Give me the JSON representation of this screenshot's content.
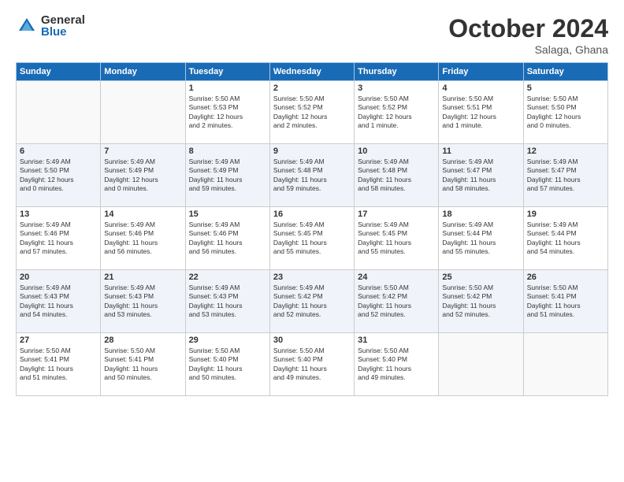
{
  "header": {
    "logo_general": "General",
    "logo_blue": "Blue",
    "month_title": "October 2024",
    "location": "Salaga, Ghana"
  },
  "weekdays": [
    "Sunday",
    "Monday",
    "Tuesday",
    "Wednesday",
    "Thursday",
    "Friday",
    "Saturday"
  ],
  "weeks": [
    [
      {
        "day": "",
        "info": ""
      },
      {
        "day": "",
        "info": ""
      },
      {
        "day": "1",
        "info": "Sunrise: 5:50 AM\nSunset: 5:53 PM\nDaylight: 12 hours\nand 2 minutes."
      },
      {
        "day": "2",
        "info": "Sunrise: 5:50 AM\nSunset: 5:52 PM\nDaylight: 12 hours\nand 2 minutes."
      },
      {
        "day": "3",
        "info": "Sunrise: 5:50 AM\nSunset: 5:52 PM\nDaylight: 12 hours\nand 1 minute."
      },
      {
        "day": "4",
        "info": "Sunrise: 5:50 AM\nSunset: 5:51 PM\nDaylight: 12 hours\nand 1 minute."
      },
      {
        "day": "5",
        "info": "Sunrise: 5:50 AM\nSunset: 5:50 PM\nDaylight: 12 hours\nand 0 minutes."
      }
    ],
    [
      {
        "day": "6",
        "info": "Sunrise: 5:49 AM\nSunset: 5:50 PM\nDaylight: 12 hours\nand 0 minutes."
      },
      {
        "day": "7",
        "info": "Sunrise: 5:49 AM\nSunset: 5:49 PM\nDaylight: 12 hours\nand 0 minutes."
      },
      {
        "day": "8",
        "info": "Sunrise: 5:49 AM\nSunset: 5:49 PM\nDaylight: 11 hours\nand 59 minutes."
      },
      {
        "day": "9",
        "info": "Sunrise: 5:49 AM\nSunset: 5:48 PM\nDaylight: 11 hours\nand 59 minutes."
      },
      {
        "day": "10",
        "info": "Sunrise: 5:49 AM\nSunset: 5:48 PM\nDaylight: 11 hours\nand 58 minutes."
      },
      {
        "day": "11",
        "info": "Sunrise: 5:49 AM\nSunset: 5:47 PM\nDaylight: 11 hours\nand 58 minutes."
      },
      {
        "day": "12",
        "info": "Sunrise: 5:49 AM\nSunset: 5:47 PM\nDaylight: 11 hours\nand 57 minutes."
      }
    ],
    [
      {
        "day": "13",
        "info": "Sunrise: 5:49 AM\nSunset: 5:46 PM\nDaylight: 11 hours\nand 57 minutes."
      },
      {
        "day": "14",
        "info": "Sunrise: 5:49 AM\nSunset: 5:46 PM\nDaylight: 11 hours\nand 56 minutes."
      },
      {
        "day": "15",
        "info": "Sunrise: 5:49 AM\nSunset: 5:46 PM\nDaylight: 11 hours\nand 56 minutes."
      },
      {
        "day": "16",
        "info": "Sunrise: 5:49 AM\nSunset: 5:45 PM\nDaylight: 11 hours\nand 55 minutes."
      },
      {
        "day": "17",
        "info": "Sunrise: 5:49 AM\nSunset: 5:45 PM\nDaylight: 11 hours\nand 55 minutes."
      },
      {
        "day": "18",
        "info": "Sunrise: 5:49 AM\nSunset: 5:44 PM\nDaylight: 11 hours\nand 55 minutes."
      },
      {
        "day": "19",
        "info": "Sunrise: 5:49 AM\nSunset: 5:44 PM\nDaylight: 11 hours\nand 54 minutes."
      }
    ],
    [
      {
        "day": "20",
        "info": "Sunrise: 5:49 AM\nSunset: 5:43 PM\nDaylight: 11 hours\nand 54 minutes."
      },
      {
        "day": "21",
        "info": "Sunrise: 5:49 AM\nSunset: 5:43 PM\nDaylight: 11 hours\nand 53 minutes."
      },
      {
        "day": "22",
        "info": "Sunrise: 5:49 AM\nSunset: 5:43 PM\nDaylight: 11 hours\nand 53 minutes."
      },
      {
        "day": "23",
        "info": "Sunrise: 5:49 AM\nSunset: 5:42 PM\nDaylight: 11 hours\nand 52 minutes."
      },
      {
        "day": "24",
        "info": "Sunrise: 5:50 AM\nSunset: 5:42 PM\nDaylight: 11 hours\nand 52 minutes."
      },
      {
        "day": "25",
        "info": "Sunrise: 5:50 AM\nSunset: 5:42 PM\nDaylight: 11 hours\nand 52 minutes."
      },
      {
        "day": "26",
        "info": "Sunrise: 5:50 AM\nSunset: 5:41 PM\nDaylight: 11 hours\nand 51 minutes."
      }
    ],
    [
      {
        "day": "27",
        "info": "Sunrise: 5:50 AM\nSunset: 5:41 PM\nDaylight: 11 hours\nand 51 minutes."
      },
      {
        "day": "28",
        "info": "Sunrise: 5:50 AM\nSunset: 5:41 PM\nDaylight: 11 hours\nand 50 minutes."
      },
      {
        "day": "29",
        "info": "Sunrise: 5:50 AM\nSunset: 5:40 PM\nDaylight: 11 hours\nand 50 minutes."
      },
      {
        "day": "30",
        "info": "Sunrise: 5:50 AM\nSunset: 5:40 PM\nDaylight: 11 hours\nand 49 minutes."
      },
      {
        "day": "31",
        "info": "Sunrise: 5:50 AM\nSunset: 5:40 PM\nDaylight: 11 hours\nand 49 minutes."
      },
      {
        "day": "",
        "info": ""
      },
      {
        "day": "",
        "info": ""
      }
    ]
  ]
}
